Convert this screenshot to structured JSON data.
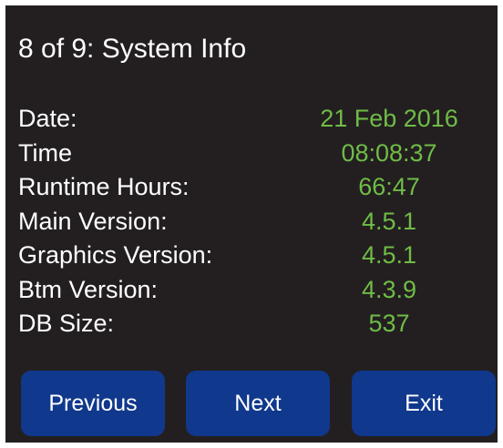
{
  "header": {
    "title": "8 of 9: System Info"
  },
  "info": {
    "rows": [
      {
        "label": "Date:",
        "value": "21 Feb 2016"
      },
      {
        "label": "Time",
        "value": "08:08:37"
      },
      {
        "label": "Runtime Hours:",
        "value": "66:47"
      },
      {
        "label": "Main Version:",
        "value": "4.5.1"
      },
      {
        "label": "Graphics Version:",
        "value": "4.5.1"
      },
      {
        "label": "Btm Version:",
        "value": "4.3.9"
      },
      {
        "label": "DB Size:",
        "value": "537"
      }
    ]
  },
  "buttons": {
    "previous": "Previous",
    "next": "Next",
    "exit": "Exit"
  },
  "colors": {
    "background": "#231f20",
    "label": "#ffffff",
    "value": "#6fbc46",
    "button": "#10388c"
  }
}
